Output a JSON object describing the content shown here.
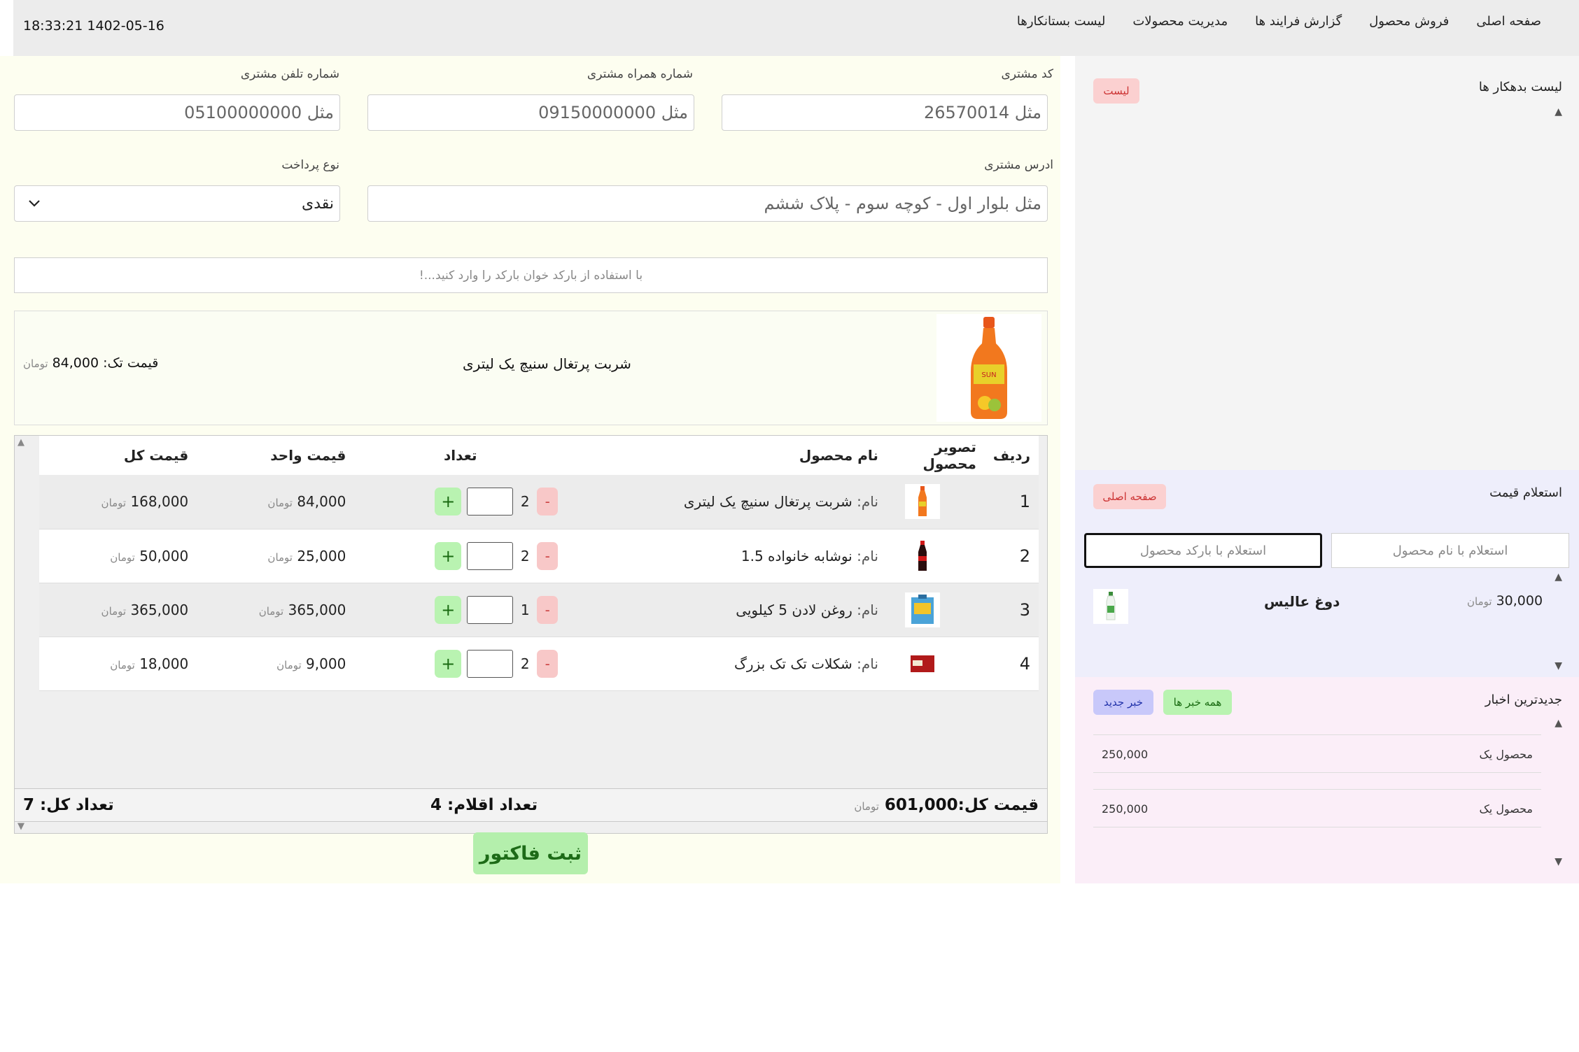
{
  "topnav": {
    "datetime": "18:33:21 1402-05-16",
    "menu": [
      "صفحه اصلی",
      "فروش محصول",
      "گزارش فرایند ها",
      "مدیریت محصولات",
      "لیست بستانکارها"
    ]
  },
  "customer": {
    "code_label": "کد مشتری",
    "code_placeholder": "مثل 26570014",
    "mobile_label": "شماره همراه مشتری",
    "mobile_placeholder": "مثل 09150000000",
    "phone_label": "شماره تلفن مشتری",
    "phone_placeholder": "مثل 05100000000",
    "address_label": "ادرس مشتری",
    "address_placeholder": "مثل بلوار اول - کوچه سوم - پلاک ششم",
    "payment_label": "نوع پرداخت",
    "payment_value": "نقدی"
  },
  "barcode": {
    "placeholder": "با استفاده از بارکد خوان بارکد را وارد کنید...!"
  },
  "current_product": {
    "name": "شربت پرتغال سنیچ یک لیتری",
    "price_label": "قیمت تک:",
    "price": "84,000",
    "unit": "تومان"
  },
  "cart": {
    "headers": {
      "row": "ردیف",
      "image": "تصویر محصول",
      "name": "نام محصول",
      "qty": "تعداد",
      "unit_price": "قیمت واحد",
      "total": "قیمت کل"
    },
    "name_prefix": "نام:",
    "unit": "تومان",
    "minus": "-",
    "plus": "+",
    "rows": [
      {
        "no": "1",
        "name": "شربت پرتغال سنیچ یک لیتری",
        "qty": "2",
        "unit_price": "84,000",
        "total": "168,000",
        "icon": "orange-bottle"
      },
      {
        "no": "2",
        "name": "نوشابه خانواده 1.5",
        "qty": "2",
        "unit_price": "25,000",
        "total": "50,000",
        "icon": "cola-bottle"
      },
      {
        "no": "3",
        "name": "روغن لادن 5 کیلویی",
        "qty": "1",
        "unit_price": "365,000",
        "total": "365,000",
        "icon": "oil-tin"
      },
      {
        "no": "4",
        "name": "شکلات تک تک بزرگ",
        "qty": "2",
        "unit_price": "9,000",
        "total": "18,000",
        "icon": "chocolate-bar"
      }
    ]
  },
  "summary": {
    "total_label": "قیمت کل:",
    "total_value": "601,000",
    "unit": "تومان",
    "items_label": "تعداد اقلام: 4",
    "count_label": "تعداد کل: 7"
  },
  "submit": {
    "label": "ثبت فاکتور"
  },
  "debtors": {
    "title": "لیست بدهکار ها",
    "button": "لیست"
  },
  "price_query": {
    "title": "استعلام قیمت",
    "button": "صفحه اصلی",
    "by_name_placeholder": "استعلام با نام محصول",
    "by_barcode_placeholder": "استعلام با بارکد محصول",
    "result": {
      "name": "دوغ عالیس",
      "price": "30,000",
      "unit": "تومان"
    }
  },
  "news": {
    "title": "جدیدترین اخبار",
    "all_button": "همه خبر ها",
    "new_button": "خبر جدید",
    "items": [
      {
        "title": "محصول یک",
        "value": "250,000"
      },
      {
        "title": "محصول یک",
        "value": "250,000"
      }
    ]
  },
  "colors": {
    "accent_green": "#b4efac",
    "accent_red": "#fbd0d0",
    "accent_blue": "#c8c8fa",
    "main_bg": "#fdfef0"
  }
}
